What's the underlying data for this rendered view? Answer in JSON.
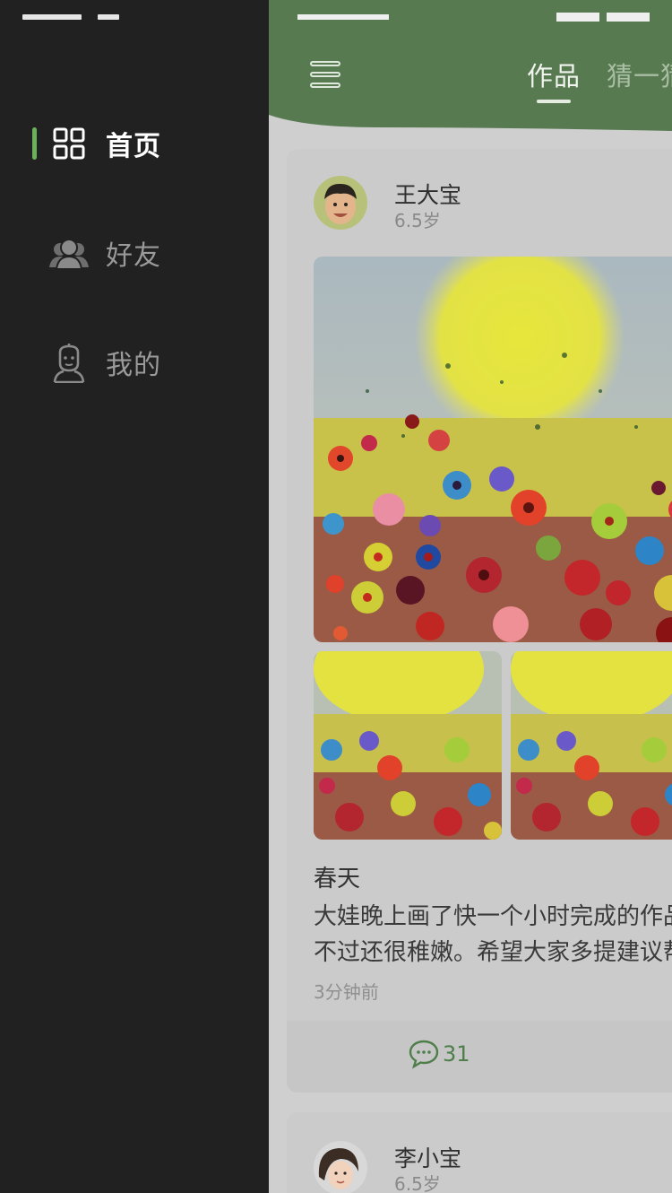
{
  "drawer": {
    "items": [
      {
        "label": "首页",
        "icon": "home-grid-icon",
        "active": true
      },
      {
        "label": "好友",
        "icon": "friends-icon",
        "active": false
      },
      {
        "label": "我的",
        "icon": "profile-icon",
        "active": false
      }
    ]
  },
  "header": {
    "tabs": [
      {
        "label": "作品",
        "active": true
      },
      {
        "label": "猜一猜",
        "active": false
      }
    ]
  },
  "posts": [
    {
      "user": "王大宝",
      "age": "6.5岁",
      "title": "春天",
      "body_lines": [
        "大娃晚上画了快一个小时完成的作品",
        "不过还很稚嫩。希望大家多提建议帮"
      ],
      "time": "3分钟前",
      "comments": "31"
    },
    {
      "user": "李小宝",
      "age": "6.5岁"
    }
  ],
  "colors": {
    "accent": "#6cb05a",
    "header_green": "#577a51",
    "drawer_bg": "#212121",
    "comment_green": "#4e7e4a"
  }
}
